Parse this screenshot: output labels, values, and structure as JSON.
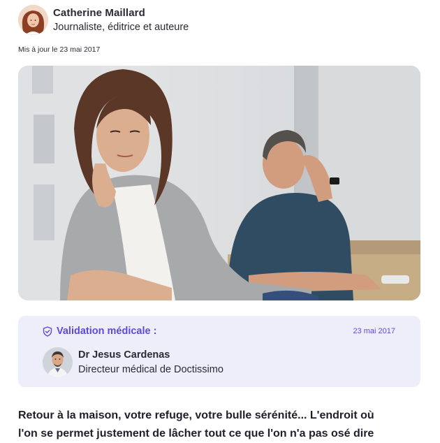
{
  "author": {
    "name": "Catherine Maillard",
    "role": "Journaliste, éditrice et auteure",
    "avatar_icon": "author-avatar-photo"
  },
  "updated": "Mis à jour le 23 mai 2017",
  "hero_image": {
    "icon": "couple-argument-photo"
  },
  "validation": {
    "title": "Validation médicale :",
    "date": "23 mai 2017",
    "icon": "shield-check-icon",
    "accent_color": "#5b4bd6",
    "background": "#eeeefb",
    "doctor": {
      "name": "Dr Jesus Cardenas",
      "role": "Directeur médical de Doctissimo",
      "avatar_icon": "doctor-avatar-photo"
    }
  },
  "intro": {
    "line1": "Retour à la maison, votre refuge, votre bulle sérénité... L'endroit où",
    "line2": "l'on se permet justement de lâcher tout ce que l'on n'a pas osé dire"
  }
}
